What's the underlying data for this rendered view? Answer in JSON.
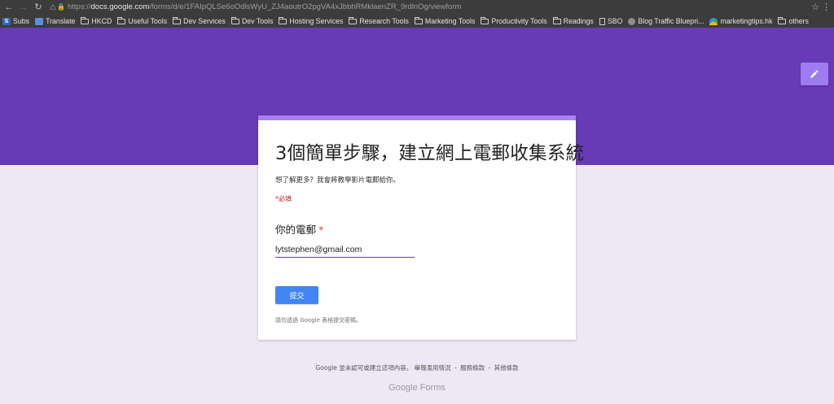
{
  "browser": {
    "url_prefix": "https://",
    "url_host": "docs.google.com",
    "url_path": "/forms/d/e/1FAIpQLSe6oOdlsWyU_ZJ4aoutrO2pgVA4xJbbhRMklaenZR_9rdlnOg/viewform",
    "bookmarks": [
      {
        "label": "Subs",
        "icon": "subs-icon"
      },
      {
        "label": "Translate",
        "icon": "translate-icon"
      },
      {
        "label": "HKCD",
        "icon": "folder-icon"
      },
      {
        "label": "Useful Tools",
        "icon": "folder-icon"
      },
      {
        "label": "Dev Services",
        "icon": "folder-icon"
      },
      {
        "label": "Dev Tools",
        "icon": "folder-icon"
      },
      {
        "label": "Hosting Services",
        "icon": "folder-icon"
      },
      {
        "label": "Research Tools",
        "icon": "folder-icon"
      },
      {
        "label": "Marketing Tools",
        "icon": "folder-icon"
      },
      {
        "label": "Productivity Tools",
        "icon": "folder-icon"
      },
      {
        "label": "Readings",
        "icon": "folder-icon"
      },
      {
        "label": "SBO",
        "icon": "page-icon"
      },
      {
        "label": "Blog Traffic Bluepri...",
        "icon": "blog-icon"
      },
      {
        "label": "marketingtips.hk",
        "icon": "marketingtips-icon"
      },
      {
        "label": "others",
        "icon": "folder-icon"
      }
    ]
  },
  "form": {
    "title": "3個簡單步驟，建立網上電郵收集系統",
    "description": "想了解更多？我會將教學影片電郵給你。",
    "required_note": "*必填",
    "question_label": "你的電郵",
    "required_mark": "*",
    "email_value": "lytstephen@gmail.com",
    "submit_label": "提交",
    "password_warning": "請勿透過 Google 表格提交密碼。"
  },
  "footer": {
    "notice": "Google 並未認可或建立這項內容。",
    "report_abuse": "舉報濫用情況",
    "terms": "服務條款",
    "other_terms": "其他條款",
    "separator": "-",
    "logo_google": "Google",
    "logo_forms": "Forms"
  },
  "colors": {
    "header": "#673ab7",
    "background": "#ede7f6",
    "submit": "#4285f4",
    "card_accent": "#a881ef"
  }
}
